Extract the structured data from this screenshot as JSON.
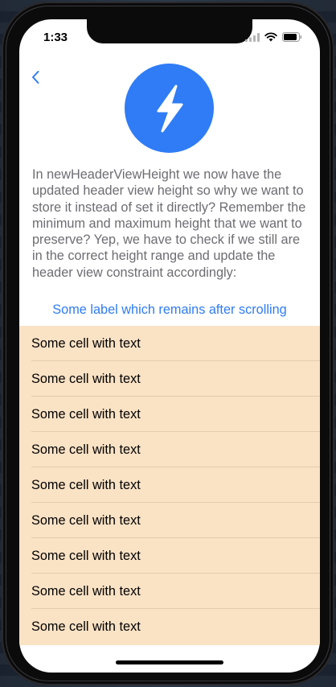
{
  "status_bar": {
    "time": "1:33"
  },
  "nav": {
    "back_icon": "chevron-left-icon"
  },
  "header": {
    "logo_icon": "lightning-bolt-icon",
    "logo_color": "#2f7cf6",
    "description": "In newHeaderViewHeight we now have the updated header view height so why we want to store it instead of set it directly? Remember the minimum and maximum height that we want to preserve? Yep, we have to check if we still are in the correct height range and update the header view constraint accordingly:",
    "sticky_label": "Some label which remains after scrolling"
  },
  "table": {
    "background": "#fae2c5",
    "cells": [
      "Some cell with text",
      "Some cell with text",
      "Some cell with text",
      "Some cell with text",
      "Some cell with text",
      "Some cell with text",
      "Some cell with text",
      "Some cell with text",
      "Some cell with text"
    ]
  }
}
